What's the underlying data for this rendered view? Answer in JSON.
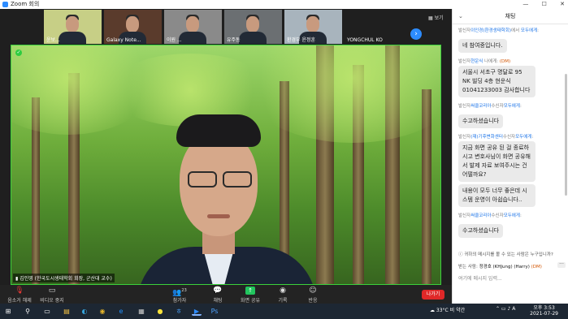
{
  "window": {
    "title": "Zoom 회의",
    "controls": [
      "—",
      "☐",
      "✕"
    ]
  },
  "gallery": {
    "view_label": "▦ 보기",
    "next_icon": "chevron-right-icon",
    "thumbnails": [
      {
        "name": "윤보...",
        "bg": "#c7cf86"
      },
      {
        "name": "Galaxy Note...",
        "bg": "#5a3b2c"
      },
      {
        "name": "이원 ...",
        "bg": "#8a8a8a"
      },
      {
        "name": "유주동",
        "bg": "#6b6f72"
      },
      {
        "name": "환경부 윤정훈",
        "bg": "#a8b4bd"
      },
      {
        "name": "YONGCHUL KO",
        "bg": "#1f1f1f",
        "blank": true
      }
    ]
  },
  "main_video": {
    "speaker_label": "김인영 (한국도시생태학회 회장, 군산대 교수)"
  },
  "toolbar": {
    "mute": {
      "icon": "mic-muted-icon",
      "label": "음소거 해제"
    },
    "video": {
      "icon": "video-off-icon",
      "label": "비디오 중지"
    },
    "participants": {
      "icon": "people-icon",
      "label": "참가자",
      "count": "23"
    },
    "chat": {
      "icon": "chat-icon",
      "label": "채팅"
    },
    "share": {
      "icon": "share-screen-icon",
      "label": "화면 공유"
    },
    "record": {
      "icon": "record-icon",
      "label": "기록"
    },
    "reactions": {
      "icon": "emoji-icon",
      "label": "반응"
    },
    "leave": "나가기"
  },
  "chat": {
    "title": "채팅",
    "messages": [
      {
        "meta": [
          "발신자",
          "이인경(환경생태학회)",
          "에서 ",
          "모두에게",
          ":"
        ],
        "text": "네 참여중입니다."
      },
      {
        "meta": [
          "발신자",
          "현운식",
          " 나에게: ",
          "(DM)",
          ""
        ],
        "text": "서울시 서초구 명달로 95 NK 빌딩 4층 현운식 01041233003 감사합니다"
      },
      {
        "meta": [
          "발신자",
          "써클코리아",
          "수신자",
          "모두에게",
          ":"
        ],
        "text": "수고하셨습니다"
      },
      {
        "meta": [
          "발신자",
          "(재)기후변화센터",
          "수신자",
          "모두에게",
          ":"
        ],
        "text": "지금 화면 공유 된 걸 종료하시고 변호사님이 화면 공유해서 발제 자료 보여주시는 건 어떨까요?"
      },
      {
        "meta": [
          "",
          "",
          "",
          "",
          ""
        ],
        "text": "내용이 모두 너무 좋은데 시스템 운영이 아쉽습니다.."
      },
      {
        "meta": [
          "발신자",
          "써클코리아",
          "수신자",
          "모두에게",
          ":"
        ],
        "text": "수고하셨습니다"
      }
    ],
    "notice": "귀하의 메시지를 볼 수 있는 사람은 누구입니까?",
    "send_to_label": "받는 사람:",
    "send_to_value": "정경호 (KHJung) (Harry)",
    "send_to_dm": "(DM)",
    "more": "···",
    "input_placeholder": "여기에 메시지 입력..."
  },
  "taskbar": {
    "weather": "33°C 비 약간",
    "ime": "A",
    "time": "오후 3:53",
    "date": "2021-07-29",
    "apps": [
      {
        "icon": "windows-icon",
        "glyph": "⊞",
        "color": "#ffffff",
        "active": false
      },
      {
        "icon": "search-icon",
        "glyph": "⚲",
        "color": "#ffffff",
        "active": false
      },
      {
        "icon": "task-view-icon",
        "glyph": "▭",
        "color": "#ffffff",
        "active": false
      },
      {
        "icon": "file-explorer-icon",
        "glyph": "▤",
        "color": "#f6c343",
        "active": false
      },
      {
        "icon": "edge-icon",
        "glyph": "◐",
        "color": "#36a3d9",
        "active": false
      },
      {
        "icon": "chrome-icon",
        "glyph": "◉",
        "color": "#e4b42a",
        "active": false
      },
      {
        "icon": "ie-icon",
        "glyph": "e",
        "color": "#1e90ff",
        "active": false
      },
      {
        "icon": "calculator-icon",
        "glyph": "▦",
        "color": "#cccccc",
        "active": false
      },
      {
        "icon": "kakaotalk-icon",
        "glyph": "●",
        "color": "#f7e13a",
        "active": false
      },
      {
        "icon": "hwp-icon",
        "glyph": "ㅎ",
        "color": "#4aa3ff",
        "active": false
      },
      {
        "icon": "zoom-icon",
        "glyph": "▶",
        "color": "#2d8cff",
        "active": true
      },
      {
        "icon": "photoshop-icon",
        "glyph": "Ps",
        "color": "#4ea4ff",
        "active": false
      }
    ]
  }
}
